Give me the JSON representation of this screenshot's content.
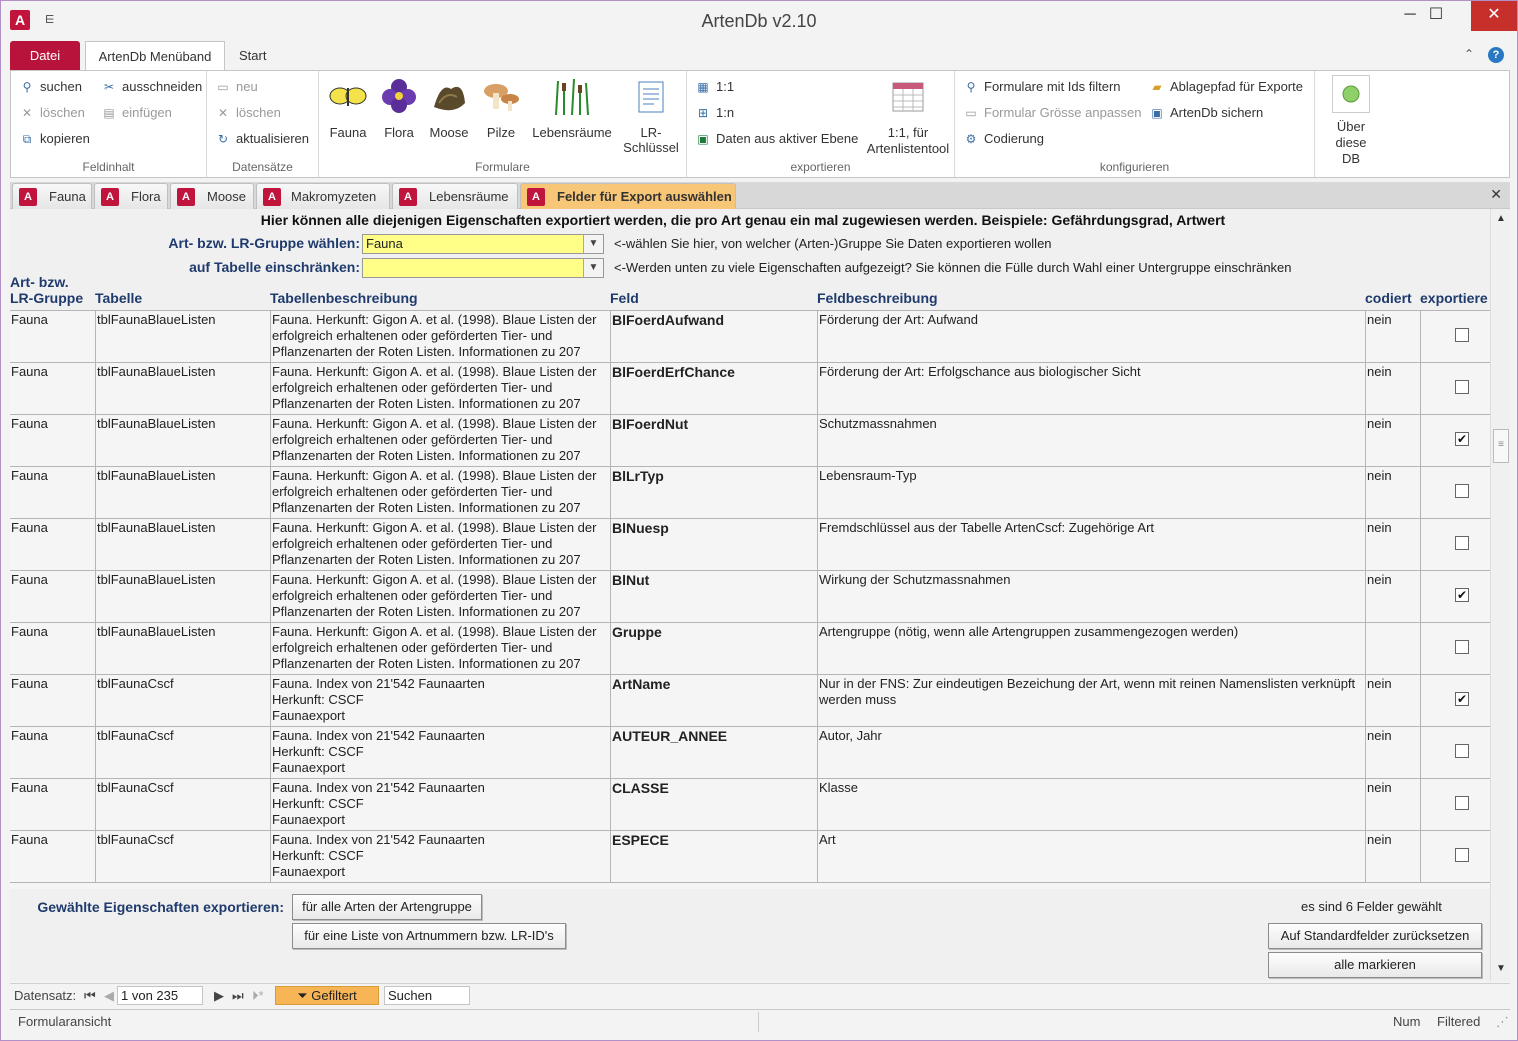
{
  "window": {
    "title": "ArtenDb v2.10",
    "qat": "⋿"
  },
  "ribbon_tabs": {
    "file": "Datei",
    "menu": "ArtenDb Menüband",
    "start": "Start"
  },
  "ribbon": {
    "feldinhalt": {
      "label": "Feldinhalt",
      "suchen": "suchen",
      "loeschen": "löschen",
      "kopieren": "kopieren",
      "ausschneiden": "ausschneiden",
      "einfuegen": "einfügen"
    },
    "datensaetze": {
      "label": "Datensätze",
      "neu": "neu",
      "loeschen": "löschen",
      "aktualisieren": "aktualisieren"
    },
    "formulare": {
      "label": "Formulare",
      "fauna": "Fauna",
      "flora": "Flora",
      "moose": "Moose",
      "pilze": "Pilze",
      "lebensraeume": "Lebensräume",
      "lrschluessel": "LR-Schlüssel"
    },
    "exportieren": {
      "label": "exportieren",
      "one_one": "1:1",
      "one_n": "1:n",
      "aktive_ebene": "Daten aus aktiver Ebene",
      "artenlistentool": "1:1, für Artenlistentool"
    },
    "konfigurieren": {
      "label": "konfigurieren",
      "formulare_ids": "Formulare mit Ids filtern",
      "groesse": "Formular Grösse anpassen",
      "codierung": "Codierung",
      "ablagepfad": "Ablagepfad für Exporte",
      "sichern": "ArtenDb sichern",
      "ueber": "Über diese DB"
    }
  },
  "doc_tabs": [
    "Fauna",
    "Flora",
    "Moose",
    "Makromyzeten",
    "Lebensräume",
    "Felder für Export auswählen"
  ],
  "form": {
    "headline": "Hier können alle diejenigen Eigenschaften exportiert werden, die pro Art genau ein mal zugewiesen werden. Beispiele: Gefährdungsgrad, Artwert",
    "gruppe_label": "Art- bzw. LR-Gruppe wählen:",
    "gruppe_value": "Fauna",
    "gruppe_hint": "<-wählen Sie hier, von welcher (Arten-)Gruppe Sie Daten exportieren wollen",
    "tabelle_label": "auf Tabelle einschränken:",
    "tabelle_value": "",
    "tabelle_hint": "<-Werden unten zu viele Eigenschaften aufgezeigt? Sie können die Fülle durch Wahl einer Untergruppe einschränken",
    "columns": {
      "gruppe1": "Art- bzw.",
      "gruppe2": "LR-Gruppe",
      "tabelle": "Tabelle",
      "tabbeschr": "Tabellenbeschreibung",
      "feld": "Feld",
      "feldbeschr": "Feldbeschreibung",
      "codiert": "codiert",
      "exportiere": "exportiere"
    },
    "rows": [
      {
        "gruppe": "Fauna",
        "tabelle": "tblFaunaBlaueListen",
        "tabbeschr": "Fauna. Herkunft: Gigon A. et al. (1998). Blaue Listen der erfolgreich erhaltenen oder geförderten Tier- und Pflanzenarten der Roten Listen. Informationen zu 207",
        "feld": "BlFoerdAufwand",
        "feldbeschr": "Förderung der Art: Aufwand",
        "codiert": "nein",
        "export": ""
      },
      {
        "gruppe": "Fauna",
        "tabelle": "tblFaunaBlaueListen",
        "tabbeschr": "Fauna. Herkunft: Gigon A. et al. (1998). Blaue Listen der erfolgreich erhaltenen oder geförderten Tier- und Pflanzenarten der Roten Listen. Informationen zu 207",
        "feld": "BlFoerdErfChance",
        "feldbeschr": "Förderung der Art: Erfolgschance aus biologischer Sicht",
        "codiert": "nein",
        "export": ""
      },
      {
        "gruppe": "Fauna",
        "tabelle": "tblFaunaBlaueListen",
        "tabbeschr": "Fauna. Herkunft: Gigon A. et al. (1998). Blaue Listen der erfolgreich erhaltenen oder geförderten Tier- und Pflanzenarten der Roten Listen. Informationen zu 207",
        "feld": "BlFoerdNut",
        "feldbeschr": "Schutzmassnahmen",
        "codiert": "nein",
        "export": "✔"
      },
      {
        "gruppe": "Fauna",
        "tabelle": "tblFaunaBlaueListen",
        "tabbeschr": "Fauna. Herkunft: Gigon A. et al. (1998). Blaue Listen der erfolgreich erhaltenen oder geförderten Tier- und Pflanzenarten der Roten Listen. Informationen zu 207",
        "feld": "BlLrTyp",
        "feldbeschr": "Lebensraum-Typ",
        "codiert": "nein",
        "export": ""
      },
      {
        "gruppe": "Fauna",
        "tabelle": "tblFaunaBlaueListen",
        "tabbeschr": "Fauna. Herkunft: Gigon A. et al. (1998). Blaue Listen der erfolgreich erhaltenen oder geförderten Tier- und Pflanzenarten der Roten Listen. Informationen zu 207",
        "feld": "BlNuesp",
        "feldbeschr": "Fremdschlüssel aus der Tabelle ArtenCscf: Zugehörige Art",
        "codiert": "nein",
        "export": ""
      },
      {
        "gruppe": "Fauna",
        "tabelle": "tblFaunaBlaueListen",
        "tabbeschr": "Fauna. Herkunft: Gigon A. et al. (1998). Blaue Listen der erfolgreich erhaltenen oder geförderten Tier- und Pflanzenarten der Roten Listen. Informationen zu 207",
        "feld": "BlNut",
        "feldbeschr": "Wirkung der Schutzmassnahmen",
        "codiert": "nein",
        "export": "✔"
      },
      {
        "gruppe": "Fauna",
        "tabelle": "tblFaunaBlaueListen",
        "tabbeschr": "Fauna. Herkunft: Gigon A. et al. (1998). Blaue Listen der erfolgreich erhaltenen oder geförderten Tier- und Pflanzenarten der Roten Listen. Informationen zu 207",
        "feld": "Gruppe",
        "feldbeschr": "Artengruppe (nötig, wenn alle Artengruppen zusammengezogen werden)",
        "codiert": "",
        "export": ""
      },
      {
        "gruppe": "Fauna",
        "tabelle": "tblFaunaCscf",
        "tabbeschr": "Fauna. Index von 21'542 Faunaarten\nHerkunft: CSCF\nFaunaexport",
        "feld": "ArtName",
        "feldbeschr": "Nur in der FNS: Zur eindeutigen Bezeichung der Art, wenn mit reinen Namenslisten verknüpft werden muss",
        "codiert": "nein",
        "export": "✔"
      },
      {
        "gruppe": "Fauna",
        "tabelle": "tblFaunaCscf",
        "tabbeschr": "Fauna. Index von 21'542 Faunaarten\nHerkunft: CSCF\nFaunaexport",
        "feld": "AUTEUR_ANNEE",
        "feldbeschr": "Autor, Jahr",
        "codiert": "nein",
        "export": ""
      },
      {
        "gruppe": "Fauna",
        "tabelle": "tblFaunaCscf",
        "tabbeschr": "Fauna. Index von 21'542 Faunaarten\nHerkunft: CSCF\nFaunaexport",
        "feld": "CLASSE",
        "feldbeschr": "Klasse",
        "codiert": "nein",
        "export": ""
      },
      {
        "gruppe": "Fauna",
        "tabelle": "tblFaunaCscf",
        "tabbeschr": "Fauna. Index von 21'542 Faunaarten\nHerkunft: CSCF\nFaunaexport",
        "feld": "ESPECE",
        "feldbeschr": "Art",
        "codiert": "nein",
        "export": ""
      }
    ],
    "export_label": "Gewählte Eigenschaften exportieren:",
    "btn_alle_arten": "für alle Arten der Artengruppe",
    "btn_liste": "für eine Liste von Artnummern bzw. LR-ID's",
    "count_text": "es sind 6 Felder gewählt",
    "btn_standard": "Auf Standardfelder zurücksetzen",
    "btn_markieren": "alle markieren"
  },
  "recnav": {
    "label": "Datensatz:",
    "position": "1 von 235",
    "filter": "Gefiltert",
    "search": "Suchen"
  },
  "status": {
    "view": "Formularansicht",
    "num": "Num",
    "filtered": "Filtered"
  }
}
